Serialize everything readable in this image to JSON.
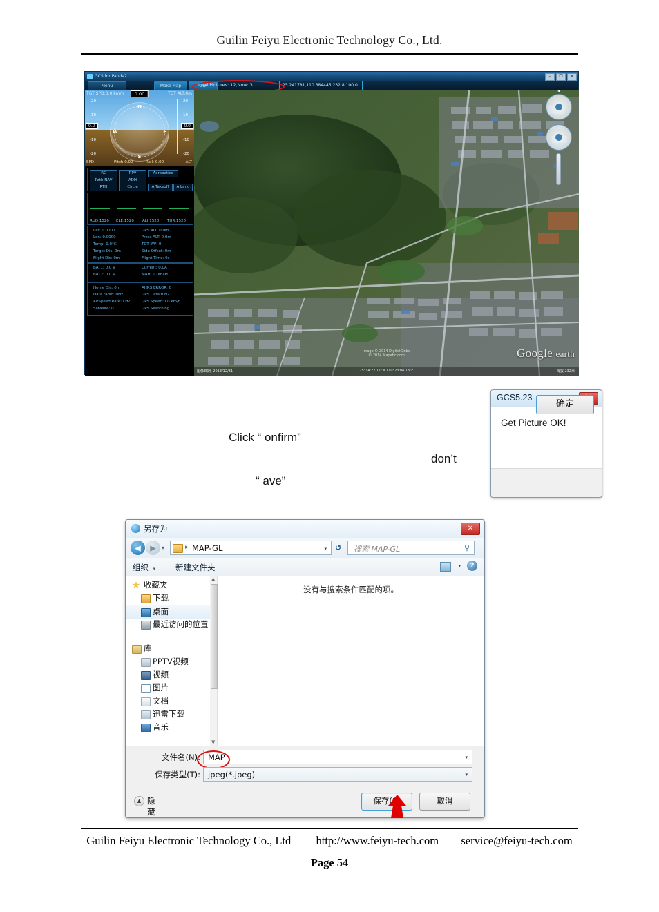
{
  "page": {
    "header_title": "Guilin Feiyu Electronic Technology Co., Ltd.",
    "footer_company": "Guilin Feiyu Electronic Technology Co., Ltd",
    "footer_url": "http://www.feiyu-tech.com",
    "footer_email": "service@feiyu-tech.com",
    "page_number": "Page 54"
  },
  "instructions": {
    "line1": "Click “  onfirm”",
    "line2": "don’t",
    "line3": "“  ave”"
  },
  "gcs": {
    "window_title": "GCS for Panda2",
    "window_buttons": [
      "–",
      "❐",
      "✕"
    ],
    "toolbar": {
      "menu": "Menu",
      "make_map": "Make Map",
      "three_d": "3D",
      "pictures_status": "Total Pictures: 12,Now: 3",
      "coordinates": "25.241781,110.384445,232.8,100,0"
    },
    "hud": {
      "tgt_spd": "TGT SPD:0.0 km/h",
      "tgt_alt": "TGT ALT:0m",
      "heading_value": "0.00",
      "spd_value": "0.0",
      "alt_value": "0.0",
      "compass_labels": [
        "N",
        "E",
        "S",
        "W"
      ],
      "spd_ticks": [
        "20",
        "10",
        "-10",
        "-20"
      ],
      "alt_ticks": [
        "20",
        "10",
        "-10",
        "-20"
      ],
      "footer": {
        "spd": "SPD",
        "pitch": "Pitch:0.00",
        "roll": "Roll:-0.00",
        "alt": "ALT"
      }
    },
    "mode_buttons": [
      "RC",
      "RPV",
      "Aerobatics",
      "Path NAV",
      "ADH",
      "RTH",
      "Circle",
      "A Takeoff",
      "A Land"
    ],
    "channels": [
      {
        "label": "RUD:1520"
      },
      {
        "label": "ELE:1520"
      },
      {
        "label": "ALI:1520"
      },
      {
        "label": "THR:1520"
      }
    ],
    "telemetry": {
      "panel1_left": [
        "Lat: 0.0000",
        "Lon: 0.0000",
        "Temp: 0.0°C",
        "Target Dis: 0m",
        "Flight Dis: 0m"
      ],
      "panel1_right": [
        "GPS ALT: 0.0m",
        "Press ALT: 0.0m",
        "TGT WP: 0",
        "Side Offset: 0m",
        "Flight Time: 0s"
      ],
      "panel2_left": [
        "BAT1: 0.0 V",
        "BAT2: 0.0 V"
      ],
      "panel2_right": [
        "Current: 0.0A",
        "MAH: 0.0maH"
      ],
      "panel3_left": [
        "Home Dis: 0m",
        "Data radio: 0Hz",
        "AirSpeed Rate:0 HZ",
        "Satallite: 0"
      ],
      "panel3_right": [
        "AHRS ERROR: 0",
        "GPS Data:0 HZ",
        "GPS Speed:0.0 km/h",
        "GPS Searching..."
      ]
    },
    "map": {
      "logo_google": "Google",
      "logo_earth": "earth",
      "attribution": "Image © 2014 DigitalGlobe",
      "attribution2": "© 2014 Mapabc.com",
      "status_left": "图像日期: 2013/12/31",
      "status_center": "25°14'27.11\"N 110°23'04.18\"E",
      "status_right": "海拔 232米",
      "nav_label": "N"
    }
  },
  "msgbox": {
    "title": "GCS5.23",
    "close_label": "✕",
    "message": "Get Picture OK!",
    "ok_label": "确定"
  },
  "saveas": {
    "title": "另存为",
    "close_label": "✕",
    "nav": {
      "back_arrow": "◀",
      "forward_arrow": "▶",
      "history_caret": "▾",
      "path_separator": "▸",
      "path": "MAP-GL",
      "address_caret": "▾",
      "refresh_label": "↺",
      "search_placeholder": "搜索 MAP-GL",
      "search_icon": "⚲"
    },
    "toolbar": {
      "organize": "组织",
      "organize_caret": "▾",
      "new_folder": "新建文件夹",
      "view_caret": "▾",
      "help": "?"
    },
    "sidebar": [
      {
        "label": "收藏夹",
        "level": 0,
        "icon": "star-icon",
        "color": "#f5c242",
        "selected": false
      },
      {
        "label": "下载",
        "level": 1,
        "icon": "download-icon",
        "color": "#e8b84a",
        "selected": false
      },
      {
        "label": "桌面",
        "level": 1,
        "icon": "desktop-icon",
        "color": "#4b8fc4",
        "selected": true
      },
      {
        "label": "最近访问的位置",
        "level": 1,
        "icon": "recent-icon",
        "color": "#9aa7b2",
        "selected": false
      },
      {
        "label": "库",
        "level": 0,
        "icon": "library-icon",
        "color": "#e0c06a",
        "selected": false
      },
      {
        "label": "PPTV视频",
        "level": 1,
        "icon": "folder-icon",
        "color": "#b9c6d2",
        "selected": false
      },
      {
        "label": "视频",
        "level": 1,
        "icon": "video-icon",
        "color": "#5e86ad",
        "selected": false
      },
      {
        "label": "图片",
        "level": 1,
        "icon": "picture-icon",
        "color": "#8fb7d6",
        "selected": false
      },
      {
        "label": "文档",
        "level": 1,
        "icon": "document-icon",
        "color": "#cfd8e0",
        "selected": false
      },
      {
        "label": "迅雷下载",
        "level": 1,
        "icon": "folder-icon",
        "color": "#b9c6d2",
        "selected": false
      },
      {
        "label": "音乐",
        "level": 1,
        "icon": "music-icon",
        "color": "#4a7fb5",
        "selected": false
      }
    ],
    "empty_message": "没有与搜索条件匹配的项。",
    "filename_label": "文件名(N):",
    "filename_value": "MAP",
    "filetype_label": "保存类型(T):",
    "filetype_value": "jpeg(*.jpeg)",
    "combo_caret": "▾",
    "hide_folders": "隐藏文件夹",
    "hide_folders_icon": "▲",
    "save_button": "保存(S)",
    "cancel_button": "取消"
  }
}
